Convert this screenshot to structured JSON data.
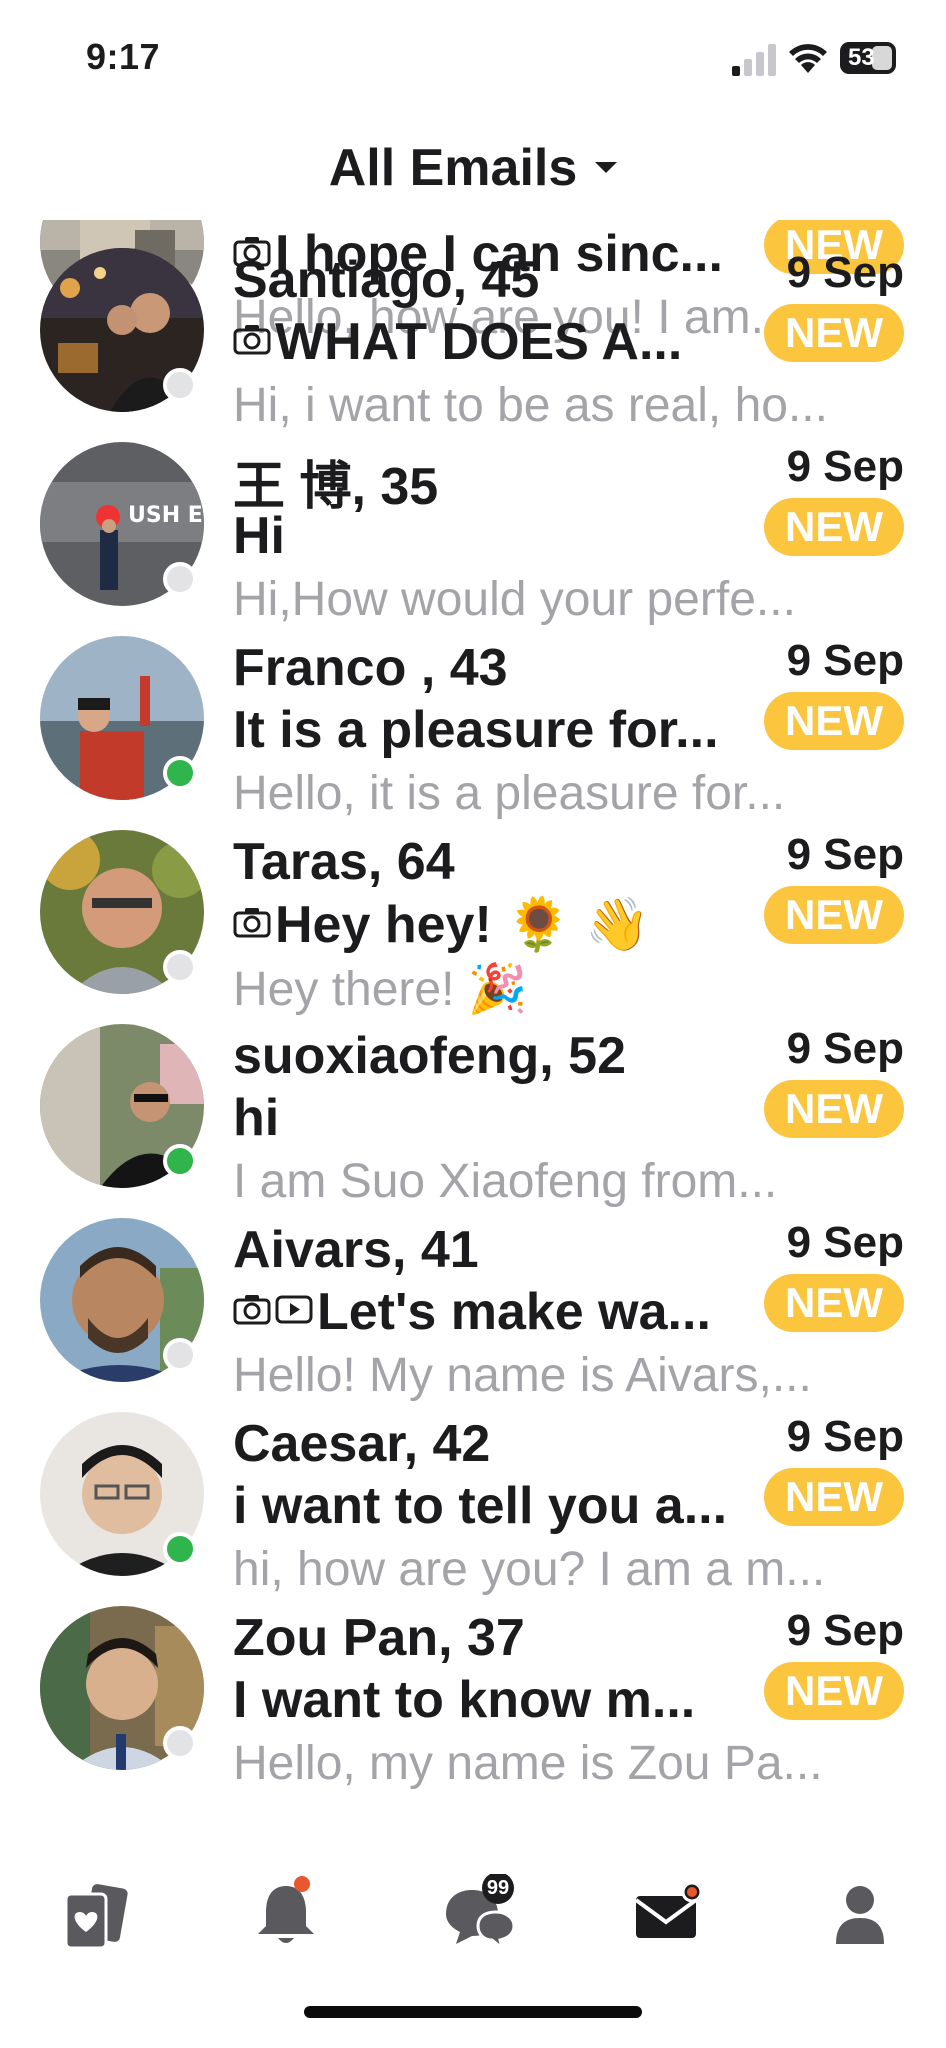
{
  "status": {
    "time": "9:17",
    "battery": "53"
  },
  "header": {
    "title": "All Emails"
  },
  "emails": [
    {
      "name": "",
      "date": "",
      "subject": "I hope I can sinc...",
      "badge": "NEW",
      "preview": "Hello, how are you!  I am...",
      "online": true,
      "icons": [
        "camera-icon"
      ]
    },
    {
      "name": "Santiago, 45",
      "date": "9 Sep",
      "subject": "WHAT DOES A...",
      "badge": "NEW",
      "preview": "Hi, i want to be as real, ho...",
      "online": false,
      "icons": [
        "camera-icon"
      ]
    },
    {
      "name": "王 博, 35",
      "date": "9 Sep",
      "subject": "Hi",
      "badge": "NEW",
      "preview": "Hi,How would your perfe...",
      "online": false,
      "icons": []
    },
    {
      "name": "Franco , 43",
      "date": "9 Sep",
      "subject": "It is a pleasure for...",
      "badge": "NEW",
      "preview": "Hello, it is a pleasure for...",
      "online": true,
      "icons": []
    },
    {
      "name": "Taras, 64",
      "date": "9 Sep",
      "subject": "Hey hey! 🌻 👋",
      "badge": "NEW",
      "preview": "Hey there! 🎉",
      "online": false,
      "icons": [
        "camera-icon"
      ]
    },
    {
      "name": "suoxiaofeng, 52",
      "date": "9 Sep",
      "subject": "hi",
      "badge": "NEW",
      "preview": "I am Suo Xiaofeng from...",
      "online": true,
      "icons": []
    },
    {
      "name": "Aivars, 41",
      "date": "9 Sep",
      "subject": "Let's make wa...",
      "badge": "NEW",
      "preview": "Hello! My name is Aivars,...",
      "online": false,
      "icons": [
        "camera-icon",
        "video-icon"
      ]
    },
    {
      "name": "Caesar, 42",
      "date": "9 Sep",
      "subject": "i want to tell you a...",
      "badge": "NEW",
      "preview": "hi, how are you? I am a m...",
      "online": true,
      "icons": []
    },
    {
      "name": "Zou Pan, 37",
      "date": "9 Sep",
      "subject": "I want to know m...",
      "badge": "NEW",
      "preview": "Hello, my name is Zou Pa...",
      "online": false,
      "icons": []
    }
  ],
  "tabbar": {
    "chat_badge": "99",
    "icons": [
      "cards-heart-icon",
      "bell-icon",
      "chat-bubbles-icon",
      "mail-icon",
      "profile-icon"
    ]
  },
  "colors": {
    "badge": "#fcc53e",
    "online": "#2fb54b",
    "preview": "#a4a4a8",
    "notify_dot": "#e8572e"
  }
}
